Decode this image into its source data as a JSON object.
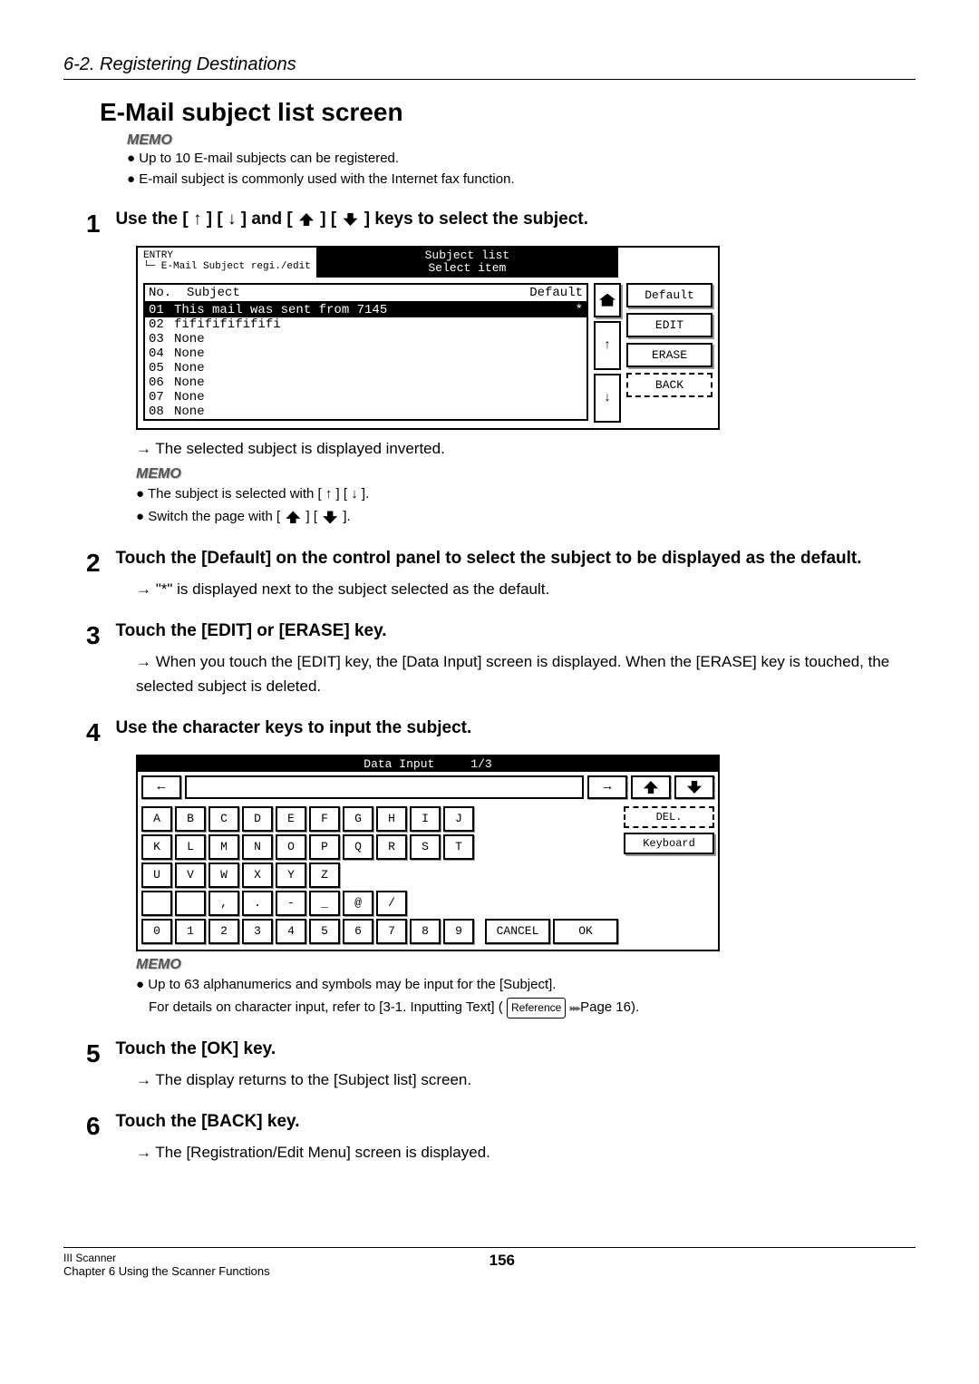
{
  "header": {
    "section": "6-2. Registering Destinations"
  },
  "title": "E-Mail subject list screen",
  "intro_memo": {
    "label": "MEMO",
    "bullets": [
      "Up to 10 E-mail subjects can be registered.",
      "E-mail subject is commonly used with the Internet fax function."
    ]
  },
  "steps": {
    "s1": {
      "num": "1",
      "title_pre": "Use the [ ↑ ] [ ↓ ] and [",
      "title_mid": "] [",
      "title_post": "] keys to select the subject.",
      "panel": {
        "entry": "ENTRY",
        "entry_sub": "└─ E-Mail Subject regi./edit",
        "top_center_l1": "Subject list",
        "top_center_l2": "Select item",
        "col_no": "No.",
        "col_subject": "Subject",
        "col_default": "Default",
        "rows": [
          {
            "n": "01",
            "t": "This mail was sent from 7145",
            "d": "*",
            "sel": true
          },
          {
            "n": "02",
            "t": "fififififififi",
            "d": ""
          },
          {
            "n": "03",
            "t": "None",
            "d": ""
          },
          {
            "n": "04",
            "t": "None",
            "d": ""
          },
          {
            "n": "05",
            "t": "None",
            "d": ""
          },
          {
            "n": "06",
            "t": "None",
            "d": ""
          },
          {
            "n": "07",
            "t": "None",
            "d": ""
          },
          {
            "n": "08",
            "t": "None",
            "d": ""
          }
        ],
        "btn_default": "Default",
        "btn_edit": "EDIT",
        "btn_erase": "ERASE",
        "btn_back": "BACK",
        "scroll_up": "↑",
        "scroll_down": "↓"
      },
      "result": "The selected subject is displayed inverted.",
      "memo_label": "MEMO",
      "memo_bullets": {
        "b1": "The subject is selected with [ ↑ ] [ ↓ ].",
        "b2_pre": "Switch the page with [",
        "b2_mid": "] [",
        "b2_post": "]."
      }
    },
    "s2": {
      "num": "2",
      "title": "Touch the [Default] on the control panel to select the subject to be displayed as the default.",
      "result": "\"*\" is displayed next to the subject selected as the default."
    },
    "s3": {
      "num": "3",
      "title": "Touch the [EDIT] or [ERASE] key.",
      "result": "When you touch the [EDIT] key, the [Data Input] screen is displayed. When the [ERASE] key is touched, the selected subject is deleted."
    },
    "s4": {
      "num": "4",
      "title": "Use the character keys to input the subject.",
      "kbd": {
        "title": "Data Input",
        "page": "1/3",
        "left_arrow": "←",
        "right_arrow": "→",
        "rows": [
          [
            "A",
            "B",
            "C",
            "D",
            "E",
            "F",
            "G",
            "H",
            "I",
            "J"
          ],
          [
            "K",
            "L",
            "M",
            "N",
            "O",
            "P",
            "Q",
            "R",
            "S",
            "T"
          ],
          [
            "U",
            "V",
            "W",
            "X",
            "Y",
            "Z"
          ],
          [
            "",
            " ",
            ",",
            ".",
            "-",
            "_",
            "@",
            "/"
          ],
          [
            "0",
            "1",
            "2",
            "3",
            "4",
            "5",
            "6",
            "7",
            "8",
            "9"
          ]
        ],
        "btn_del": "DEL.",
        "btn_keyboard": "Keyboard",
        "btn_cancel": "CANCEL",
        "btn_ok": "OK"
      },
      "memo_label": "MEMO",
      "memo_line1": "Up to 63 alphanumerics and symbols may be input for the [Subject].",
      "memo_line2_pre": "For details on character input, refer to [3-1. Inputting Text] (",
      "memo_ref": "Reference",
      "memo_line2_post": " Page 16)."
    },
    "s5": {
      "num": "5",
      "title": "Touch the [OK] key.",
      "result": "The display returns to the [Subject list] screen."
    },
    "s6": {
      "num": "6",
      "title": "Touch the [BACK] key.",
      "result": "The [Registration/Edit Menu] screen is displayed."
    }
  },
  "footer": {
    "l1": "III Scanner",
    "l2": "Chapter 6 Using the Scanner Functions",
    "page": "156"
  }
}
